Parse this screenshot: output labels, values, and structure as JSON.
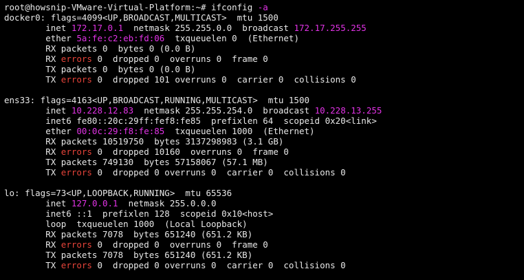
{
  "theme": {
    "background": "#000000",
    "foreground": "#e8e8e8",
    "magenta": "#e233e6",
    "red": "#e8443a"
  },
  "lines": [
    {
      "name": "prompt-line",
      "segments": [
        {
          "t": "root@howsnip-VMware-Virtual-Platform:~# ifconfig "
        },
        {
          "t": "-a",
          "c": "magenta"
        }
      ]
    },
    {
      "name": "docker0-header",
      "segments": [
        {
          "t": "docker0: flags=4099<UP,BROADCAST,MULTICAST>  mtu 1500"
        }
      ]
    },
    {
      "name": "docker0-inet",
      "segments": [
        {
          "t": "        inet "
        },
        {
          "t": "172.17.0.1",
          "c": "magenta"
        },
        {
          "t": "  netmask 255.255.0.0  broadcast "
        },
        {
          "t": "172.17.255.255",
          "c": "magenta"
        }
      ]
    },
    {
      "name": "docker0-ether",
      "segments": [
        {
          "t": "        ether "
        },
        {
          "t": "5a:fe:c2:eb:fd:06",
          "c": "magenta"
        },
        {
          "t": "  txqueuelen 0  (Ethernet)"
        }
      ]
    },
    {
      "name": "docker0-rx-packets",
      "segments": [
        {
          "t": "        RX packets 0  bytes 0 (0.0 B)"
        }
      ]
    },
    {
      "name": "docker0-rx-errors",
      "segments": [
        {
          "t": "        RX "
        },
        {
          "t": "errors",
          "c": "red"
        },
        {
          "t": " 0  dropped 0  overruns 0  frame 0"
        }
      ]
    },
    {
      "name": "docker0-tx-packets",
      "segments": [
        {
          "t": "        TX packets 0  bytes 0 (0.0 B)"
        }
      ]
    },
    {
      "name": "docker0-tx-errors",
      "segments": [
        {
          "t": "        TX "
        },
        {
          "t": "errors",
          "c": "red"
        },
        {
          "t": " 0  dropped 101 overruns 0  carrier 0  collisions 0"
        }
      ]
    },
    {
      "name": "blank-line",
      "segments": [
        {
          "t": ""
        }
      ]
    },
    {
      "name": "ens33-header",
      "segments": [
        {
          "t": "ens33: flags=4163<UP,BROADCAST,RUNNING,MULTICAST>  mtu 1500"
        }
      ]
    },
    {
      "name": "ens33-inet",
      "segments": [
        {
          "t": "        inet "
        },
        {
          "t": "10.228.12.83",
          "c": "magenta"
        },
        {
          "t": "  netmask 255.255.254.0  broadcast "
        },
        {
          "t": "10.228.13.255",
          "c": "magenta"
        }
      ]
    },
    {
      "name": "ens33-inet6",
      "segments": [
        {
          "t": "        inet6 fe80::20c:29ff:fef8:fe85  prefixlen 64  scopeid 0x20<link>"
        }
      ]
    },
    {
      "name": "ens33-ether",
      "segments": [
        {
          "t": "        ether "
        },
        {
          "t": "00:0c:29:f8:fe:85",
          "c": "magenta"
        },
        {
          "t": "  txqueuelen 1000  (Ethernet)"
        }
      ]
    },
    {
      "name": "ens33-rx-packets",
      "segments": [
        {
          "t": "        RX packets 10519750  bytes 3137298983 (3.1 GB)"
        }
      ]
    },
    {
      "name": "ens33-rx-errors",
      "segments": [
        {
          "t": "        RX "
        },
        {
          "t": "errors",
          "c": "red"
        },
        {
          "t": " 0  dropped 10160  overruns 0  frame 0"
        }
      ]
    },
    {
      "name": "ens33-tx-packets",
      "segments": [
        {
          "t": "        TX packets 749130  bytes 57158067 (57.1 MB)"
        }
      ]
    },
    {
      "name": "ens33-tx-errors",
      "segments": [
        {
          "t": "        TX "
        },
        {
          "t": "errors",
          "c": "red"
        },
        {
          "t": " 0  dropped 0 overruns 0  carrier 0  collisions 0"
        }
      ]
    },
    {
      "name": "blank-line",
      "segments": [
        {
          "t": ""
        }
      ]
    },
    {
      "name": "lo-header",
      "segments": [
        {
          "t": "lo: flags=73<UP,LOOPBACK,RUNNING>  mtu 65536"
        }
      ]
    },
    {
      "name": "lo-inet",
      "segments": [
        {
          "t": "        inet "
        },
        {
          "t": "127.0.0.1",
          "c": "magenta"
        },
        {
          "t": "  netmask 255.0.0.0"
        }
      ]
    },
    {
      "name": "lo-inet6",
      "segments": [
        {
          "t": "        inet6 ::1  prefixlen 128  scopeid 0x10<host>"
        }
      ]
    },
    {
      "name": "lo-loop",
      "segments": [
        {
          "t": "        loop  txqueuelen 1000  (Local Loopback)"
        }
      ]
    },
    {
      "name": "lo-rx-packets",
      "segments": [
        {
          "t": "        RX packets 7078  bytes 651240 (651.2 KB)"
        }
      ]
    },
    {
      "name": "lo-rx-errors",
      "segments": [
        {
          "t": "        RX "
        },
        {
          "t": "errors",
          "c": "red"
        },
        {
          "t": " 0  dropped 0  overruns 0  frame 0"
        }
      ]
    },
    {
      "name": "lo-tx-packets",
      "segments": [
        {
          "t": "        TX packets 7078  bytes 651240 (651.2 KB)"
        }
      ]
    },
    {
      "name": "lo-tx-errors",
      "segments": [
        {
          "t": "        TX "
        },
        {
          "t": "errors",
          "c": "red"
        },
        {
          "t": " 0  dropped 0 overruns 0  carrier 0  collisions 0"
        }
      ]
    }
  ]
}
